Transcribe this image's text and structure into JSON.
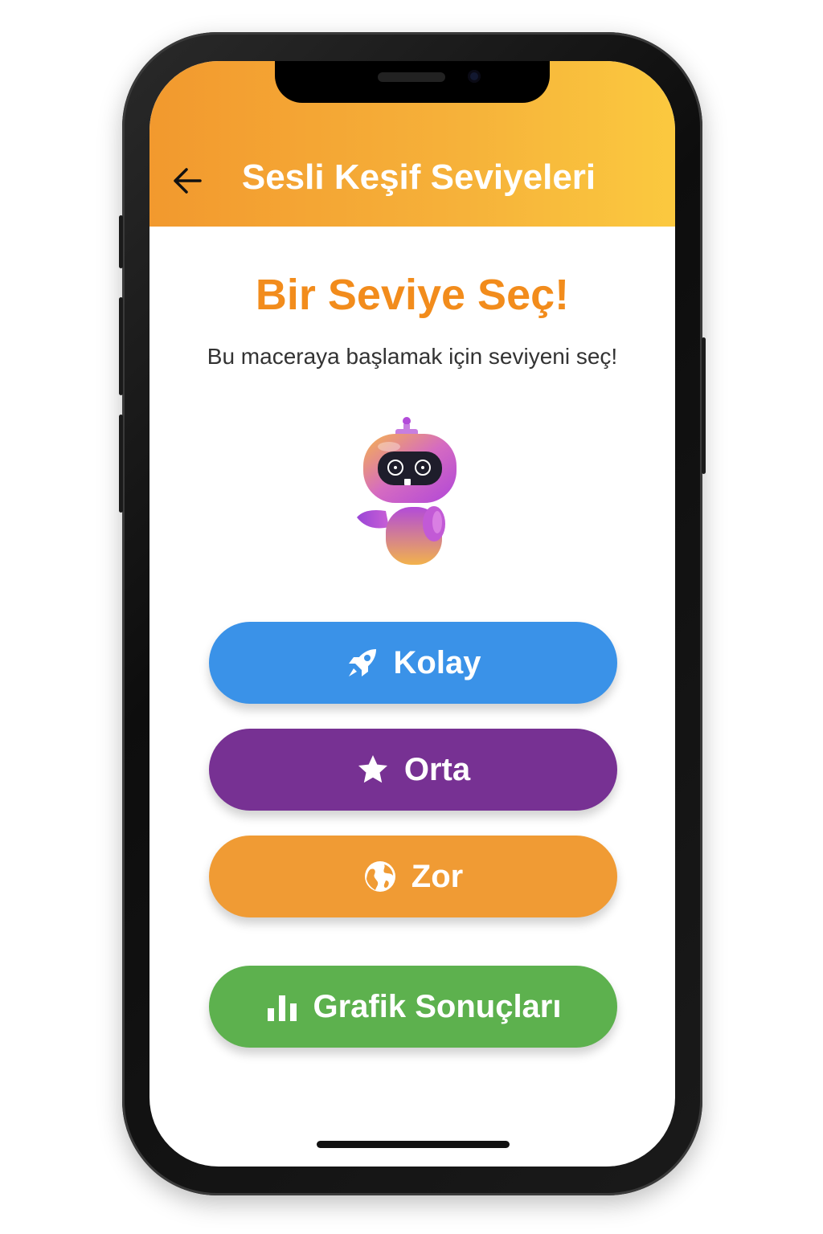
{
  "header": {
    "title": "Sesli Keşif Seviyeleri",
    "back_icon": "arrow-left-icon"
  },
  "main": {
    "title": "Bir Seviye Seç!",
    "subtitle": "Bu maceraya başlamak için seviyeni seç!",
    "mascot": "robot-mascot"
  },
  "levels": [
    {
      "label": "Kolay",
      "icon": "rocket-icon",
      "color": "#3a92e8"
    },
    {
      "label": "Orta",
      "icon": "star-icon",
      "color": "#773193"
    },
    {
      "label": "Zor",
      "icon": "globe-icon",
      "color": "#f09b34"
    }
  ],
  "results": {
    "label": "Grafik Sonuçları",
    "icon": "bar-chart-icon",
    "color": "#5db14e"
  },
  "colors": {
    "header_gradient_start": "#f2992e",
    "header_gradient_end": "#fbc93f",
    "title_orange": "#f28c1c"
  }
}
